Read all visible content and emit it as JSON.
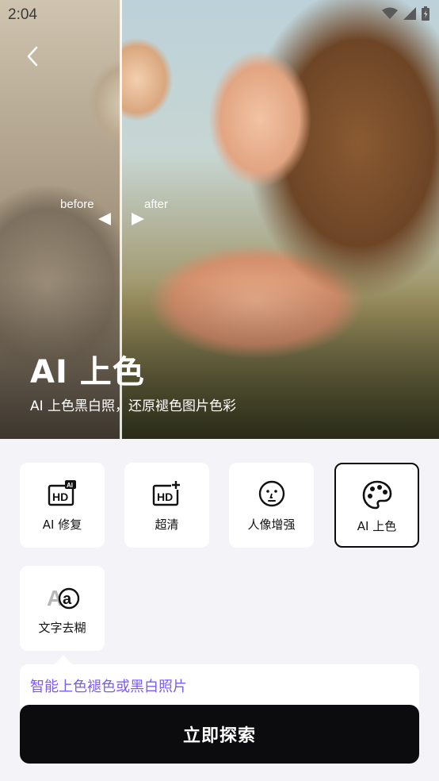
{
  "status_bar": {
    "time": "2:04"
  },
  "hero": {
    "before_label": "before",
    "after_label": "after",
    "title": "AI 上色",
    "subtitle": "AI 上色黑白照，还原褪色图片色彩"
  },
  "tools": [
    {
      "label": "AI 修复",
      "icon": "hd-ai-icon",
      "selected": false
    },
    {
      "label": "超清",
      "icon": "hd-plus-icon",
      "selected": false
    },
    {
      "label": "人像增强",
      "icon": "face-icon",
      "selected": false
    },
    {
      "label": "AI 上色",
      "icon": "palette-icon",
      "selected": true
    },
    {
      "label": "文字去糊",
      "icon": "text-deblur-icon",
      "selected": false
    }
  ],
  "tip": {
    "text": "智能上色褪色或黑白照片"
  },
  "cta": {
    "label": "立即探索"
  },
  "colors": {
    "accent": "#7a5cf0",
    "cta_bg": "#0c0c0e",
    "panel_bg": "#f4f4f8"
  }
}
